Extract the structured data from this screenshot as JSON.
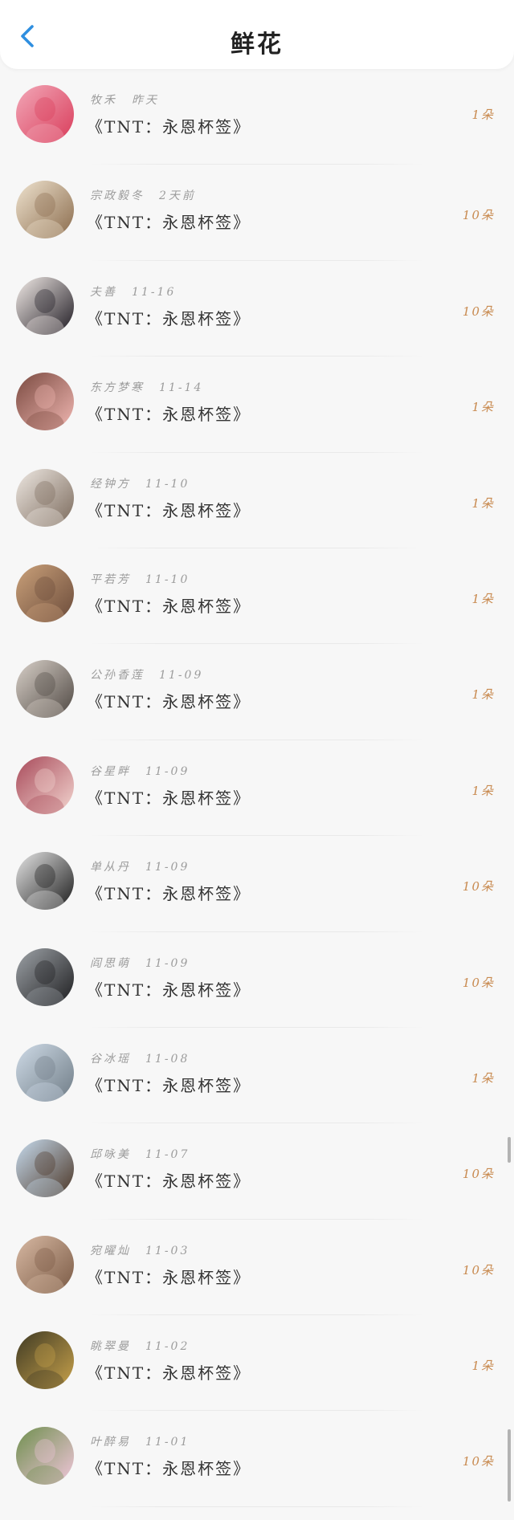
{
  "header": {
    "title": "鲜花"
  },
  "book_title": "《TNT：永恩杯签》",
  "rows": [
    {
      "name": "牧禾",
      "date": "昨天",
      "amount": "1朵",
      "colors": [
        "#f2a8b8",
        "#d93c5a"
      ]
    },
    {
      "name": "宗政毅冬",
      "date": "2天前",
      "amount": "10朵",
      "colors": [
        "#efe3cf",
        "#8a6b4c"
      ]
    },
    {
      "name": "夫善",
      "date": "11-16",
      "amount": "10朵",
      "colors": [
        "#f3ece8",
        "#1e1a22"
      ]
    },
    {
      "name": "东方梦寒",
      "date": "11-14",
      "amount": "1朵",
      "colors": [
        "#7a4a40",
        "#f1b7b2"
      ]
    },
    {
      "name": "经钟方",
      "date": "11-10",
      "amount": "1朵",
      "colors": [
        "#eee8e2",
        "#7b6a5c"
      ]
    },
    {
      "name": "平若芳",
      "date": "11-10",
      "amount": "1朵",
      "colors": [
        "#caa17a",
        "#6b4b3a"
      ]
    },
    {
      "name": "公孙香莲",
      "date": "11-09",
      "amount": "1朵",
      "colors": [
        "#d9d1c9",
        "#4e4742"
      ]
    },
    {
      "name": "谷星畔",
      "date": "11-09",
      "amount": "1朵",
      "colors": [
        "#a84a5a",
        "#f3d6d0"
      ]
    },
    {
      "name": "单从丹",
      "date": "11-09",
      "amount": "10朵",
      "colors": [
        "#e6e6e6",
        "#1b1b1b"
      ]
    },
    {
      "name": "阎思萌",
      "date": "11-09",
      "amount": "10朵",
      "colors": [
        "#9ea3a8",
        "#1d1d1f"
      ]
    },
    {
      "name": "谷冰瑶",
      "date": "11-08",
      "amount": "1朵",
      "colors": [
        "#cfdbe7",
        "#6f7c86"
      ]
    },
    {
      "name": "邱咏美",
      "date": "11-07",
      "amount": "10朵",
      "colors": [
        "#c7dcef",
        "#4b3525"
      ]
    },
    {
      "name": "宛曜灿",
      "date": "11-03",
      "amount": "10朵",
      "colors": [
        "#d8b9a3",
        "#7a5a45"
      ]
    },
    {
      "name": "眺翠曼",
      "date": "11-02",
      "amount": "1朵",
      "colors": [
        "#3f3a24",
        "#c8a24b"
      ]
    },
    {
      "name": "叶醉易",
      "date": "11-01",
      "amount": "10朵",
      "colors": [
        "#6e8f4d",
        "#f2c6dc"
      ]
    }
  ],
  "colors": {
    "accent_back": "#2f8fe0",
    "amount_color": "#c8894e"
  }
}
